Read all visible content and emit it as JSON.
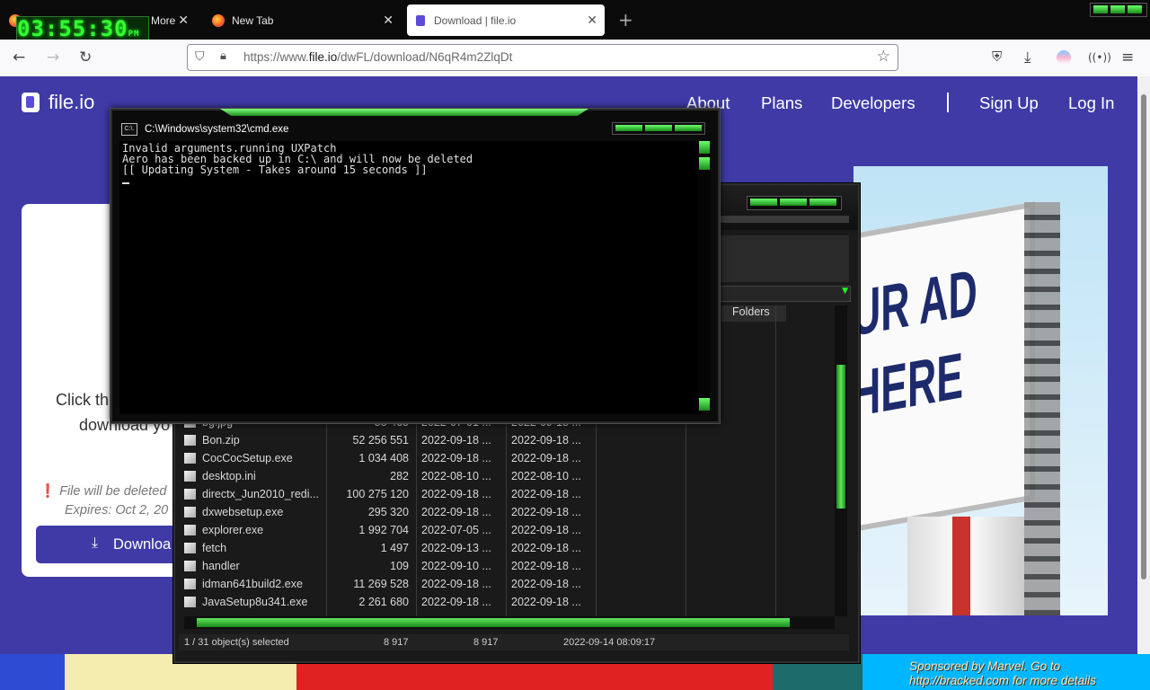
{
  "browser": {
    "tabs": [
      {
        "label": "More",
        "active": false
      },
      {
        "label": "New Tab",
        "active": false
      },
      {
        "label": "Download | file.io",
        "active": true
      }
    ],
    "url_prefix": "https://www.",
    "url_domain": "file.io",
    "url_path": "/dwFL/download/N6qR4m2ZlqDt"
  },
  "clock": {
    "time": "03:55:30",
    "suffix": "PM"
  },
  "site": {
    "logo": "file.io",
    "nav": [
      "About",
      "Plans",
      "Developers",
      "Sign Up",
      "Log In"
    ],
    "card": {
      "click_line1": "Click th",
      "click_line2": "download yo",
      "warning": "File will be deleted",
      "expires": "Expires: Oct 2, 20",
      "download_label": "Downloa"
    },
    "ad": {
      "text_line1": "UR AD",
      "text_line2": "HERE"
    },
    "sponsor_line1": "Sponsored by Marvel. Go to",
    "sponsor_line2": "http://bracked.com for more details"
  },
  "cmd": {
    "title": "C:\\Windows\\system32\\cmd.exe",
    "icon": "C:\\.",
    "lines": [
      "Invalid arguments.running UXPatch",
      "Aero has been backed up in C:\\ and will now be deleted",
      "[[ Updating System - Takes around 15 seconds ]]"
    ]
  },
  "explorer": {
    "folders_header": "Folders",
    "files": [
      {
        "name": "bg.jpg",
        "size": "55 465",
        "d1": "2022-07-01 ...",
        "d2": "2022-09-18 ..."
      },
      {
        "name": "Bon.zip",
        "size": "52 256 551",
        "d1": "2022-09-18 ...",
        "d2": "2022-09-18 ..."
      },
      {
        "name": "CocCocSetup.exe",
        "size": "1 034 408",
        "d1": "2022-09-18 ...",
        "d2": "2022-09-18 ..."
      },
      {
        "name": "desktop.ini",
        "size": "282",
        "d1": "2022-08-10 ...",
        "d2": "2022-08-10 ..."
      },
      {
        "name": "directx_Jun2010_redi...",
        "size": "100 275 120",
        "d1": "2022-09-18 ...",
        "d2": "2022-09-18 ..."
      },
      {
        "name": "dxwebsetup.exe",
        "size": "295 320",
        "d1": "2022-09-18 ...",
        "d2": "2022-09-18 ..."
      },
      {
        "name": "explorer.exe",
        "size": "1 992 704",
        "d1": "2022-07-05 ...",
        "d2": "2022-09-18 ..."
      },
      {
        "name": "fetch",
        "size": "1 497",
        "d1": "2022-09-13 ...",
        "d2": "2022-09-18 ..."
      },
      {
        "name": "handler",
        "size": "109",
        "d1": "2022-09-10 ...",
        "d2": "2022-09-18 ..."
      },
      {
        "name": "idman641build2.exe",
        "size": "11 269 528",
        "d1": "2022-09-18 ...",
        "d2": "2022-09-18 ..."
      },
      {
        "name": "JavaSetup8u341.exe",
        "size": "2 261 680",
        "d1": "2022-09-18 ...",
        "d2": "2022-09-18 ..."
      }
    ],
    "status": {
      "selected": "1 / 31 object(s) selected",
      "size1": "8 917",
      "size2": "8 917",
      "date": "2022-09-14 08:09:17"
    }
  }
}
